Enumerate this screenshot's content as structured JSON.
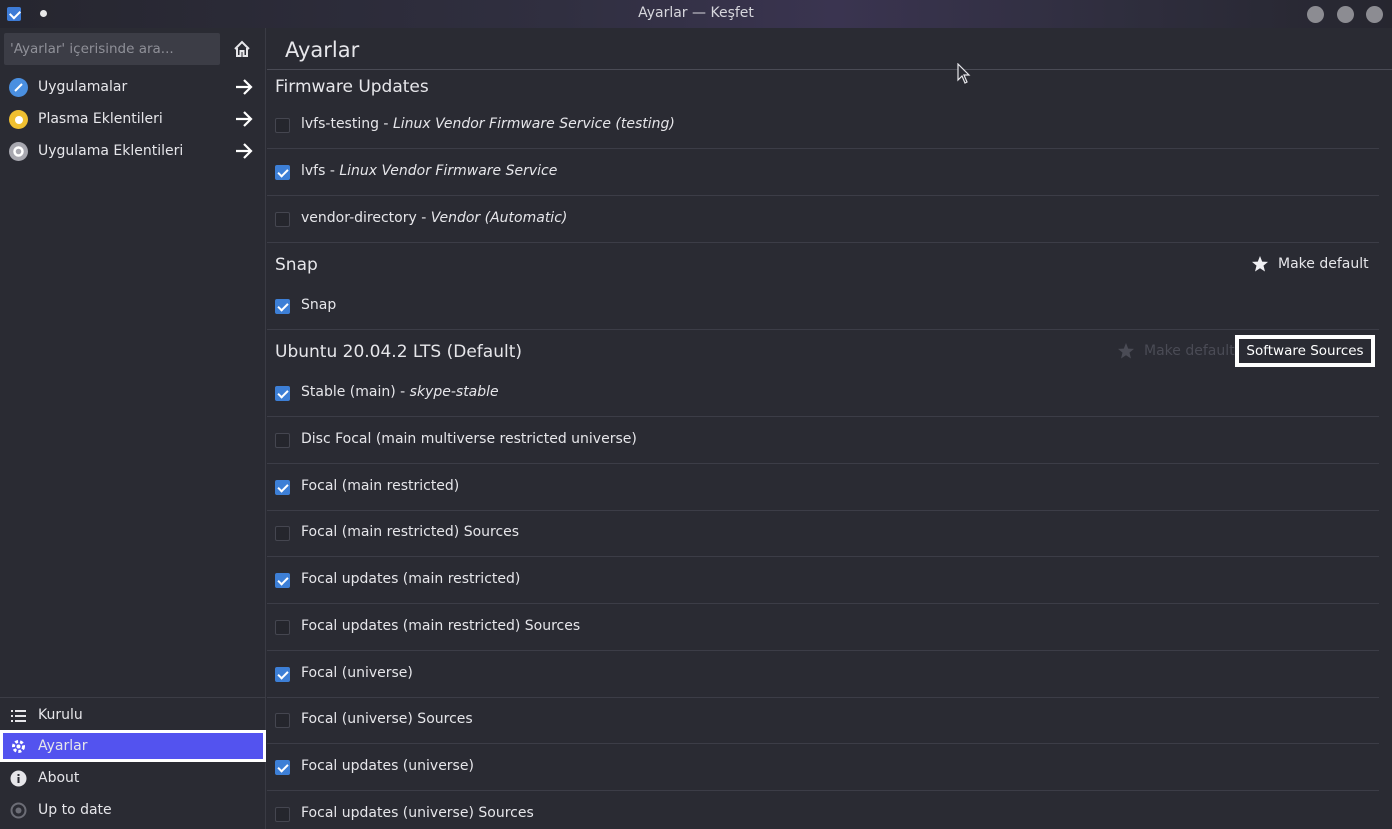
{
  "window": {
    "title": "Ayarlar — Keşfet"
  },
  "sidebar": {
    "search_placeholder": "'Ayarlar' içerisinde ara...",
    "top_items": [
      {
        "label": "Uygulamalar",
        "icon": "applications-icon",
        "color": "#4a8fe0"
      },
      {
        "label": "Plasma Eklentileri",
        "icon": "plasma-icon",
        "color": "#f0c030"
      },
      {
        "label": "Uygulama Eklentileri",
        "icon": "addons-gear-icon",
        "color": "#a8a8b0"
      }
    ],
    "bottom_items": [
      {
        "label": "Kurulu",
        "icon": "list-icon"
      },
      {
        "label": "Ayarlar",
        "icon": "gear-icon",
        "active": true
      },
      {
        "label": "About",
        "icon": "info-icon"
      },
      {
        "label": "Up to date",
        "icon": "update-icon"
      }
    ]
  },
  "main": {
    "title": "Ayarlar",
    "sections": [
      {
        "title": "Firmware Updates",
        "rows": [
          {
            "name": "lvfs-testing",
            "desc": "Linux Vendor Firmware Service (testing)",
            "checked": false
          },
          {
            "name": "lvfs",
            "desc": "Linux Vendor Firmware Service",
            "checked": true
          },
          {
            "name": "vendor-directory",
            "desc": "Vendor (Automatic)",
            "checked": false
          }
        ]
      },
      {
        "title": "Snap",
        "make_default": "Make default",
        "rows": [
          {
            "name": "Snap",
            "desc": "",
            "checked": true
          }
        ]
      },
      {
        "title": "Ubuntu 20.04.2 LTS (Default)",
        "make_default": "Make default",
        "software_sources": "Software Sources",
        "rows": [
          {
            "name": "Stable (main)",
            "desc": "skype-stable",
            "checked": true
          },
          {
            "name": "Disc Focal (main multiverse restricted universe)",
            "desc": "",
            "checked": false
          },
          {
            "name": "Focal (main restricted)",
            "desc": "",
            "checked": true
          },
          {
            "name": "Focal (main restricted) Sources",
            "desc": "",
            "checked": false
          },
          {
            "name": "Focal updates (main restricted)",
            "desc": "",
            "checked": true
          },
          {
            "name": "Focal updates (main restricted) Sources",
            "desc": "",
            "checked": false
          },
          {
            "name": "Focal (universe)",
            "desc": "",
            "checked": true
          },
          {
            "name": "Focal (universe) Sources",
            "desc": "",
            "checked": false
          },
          {
            "name": "Focal updates (universe)",
            "desc": "",
            "checked": true
          },
          {
            "name": "Focal updates (universe) Sources",
            "desc": "",
            "checked": false
          }
        ]
      }
    ]
  },
  "colors": {
    "accent": "#5353ef",
    "checkbox_on": "#3d7fd6",
    "background": "#2a2b33"
  }
}
